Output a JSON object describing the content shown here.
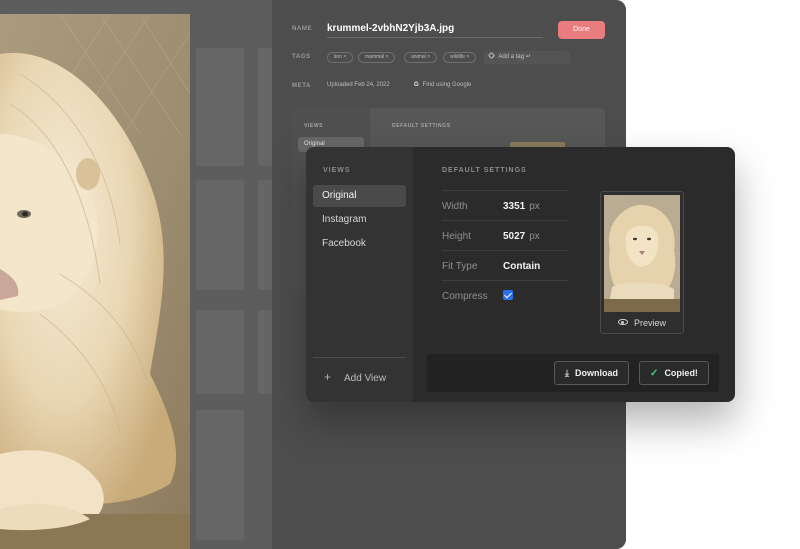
{
  "colors": {
    "accent": "#e97c7e",
    "check": "#2a6ff0",
    "success": "#3fd07c"
  },
  "file": {
    "name_label": "NAME",
    "filename": "krummel-2vbhN2Yjb3A.jpg",
    "done_label": "Done"
  },
  "tags": {
    "label": "TAGS",
    "items": [
      "lion",
      "mammal",
      "animal",
      "wildlife"
    ],
    "remove_glyph": "×",
    "add_placeholder": "Add a tag",
    "add_icon": "tag-icon",
    "return_glyph": "↵"
  },
  "meta": {
    "label": "META",
    "uploaded": "Uploaded Feb 24, 2022",
    "google_glyph": "G",
    "find_google": "Find using Google"
  },
  "ghost": {
    "views_label": "VIEWS",
    "active_item": "Original",
    "settings_label": "DEFAULT SETTINGS"
  },
  "dialog": {
    "views_label": "VIEWS",
    "views": [
      "Original",
      "Instagram",
      "Facebook"
    ],
    "active_view": "Original",
    "add_view": "Add View",
    "add_glyph": "+",
    "settings_label": "DEFAULT SETTINGS",
    "fields": {
      "width": {
        "label": "Width",
        "value": "3351",
        "unit": "px"
      },
      "height": {
        "label": "Height",
        "value": "5027",
        "unit": "px"
      },
      "fit": {
        "label": "Fit Type",
        "value": "Contain"
      },
      "compress": {
        "label": "Compress",
        "checked": true
      }
    },
    "preview_label": "Preview",
    "download_label": "Download",
    "download_glyph": "⤓",
    "copied_label": "Copied!",
    "check_glyph": "✓"
  }
}
